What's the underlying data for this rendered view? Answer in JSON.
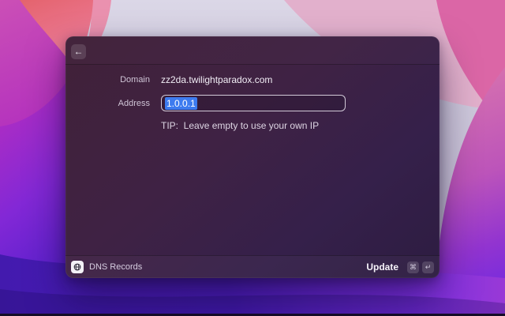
{
  "window": {
    "titlebar": {
      "back_icon": "←"
    },
    "form": {
      "domain_label": "Domain",
      "domain_value": "zz2da.twilightparadox.com",
      "address_label": "Address",
      "address_value": "1.0.0.1",
      "tip": "TIP:  Leave empty to use your own IP"
    },
    "footer": {
      "title": "DNS Records",
      "action_label": "Update",
      "shortcut_keys": [
        "⌘",
        "↵"
      ]
    }
  },
  "colors": {
    "selection_blue": "#3d7bef",
    "window_bg": "#3a2142",
    "input_border": "#eee9f4",
    "wallpaper_magenta": "#b432be",
    "wallpaper_coral": "#e4636d",
    "wallpaper_pink": "#db66a6",
    "wallpaper_lavender": "#d2cde0",
    "wallpaper_violet": "#7d27d8",
    "wallpaper_deep_blue": "#4319ab"
  }
}
